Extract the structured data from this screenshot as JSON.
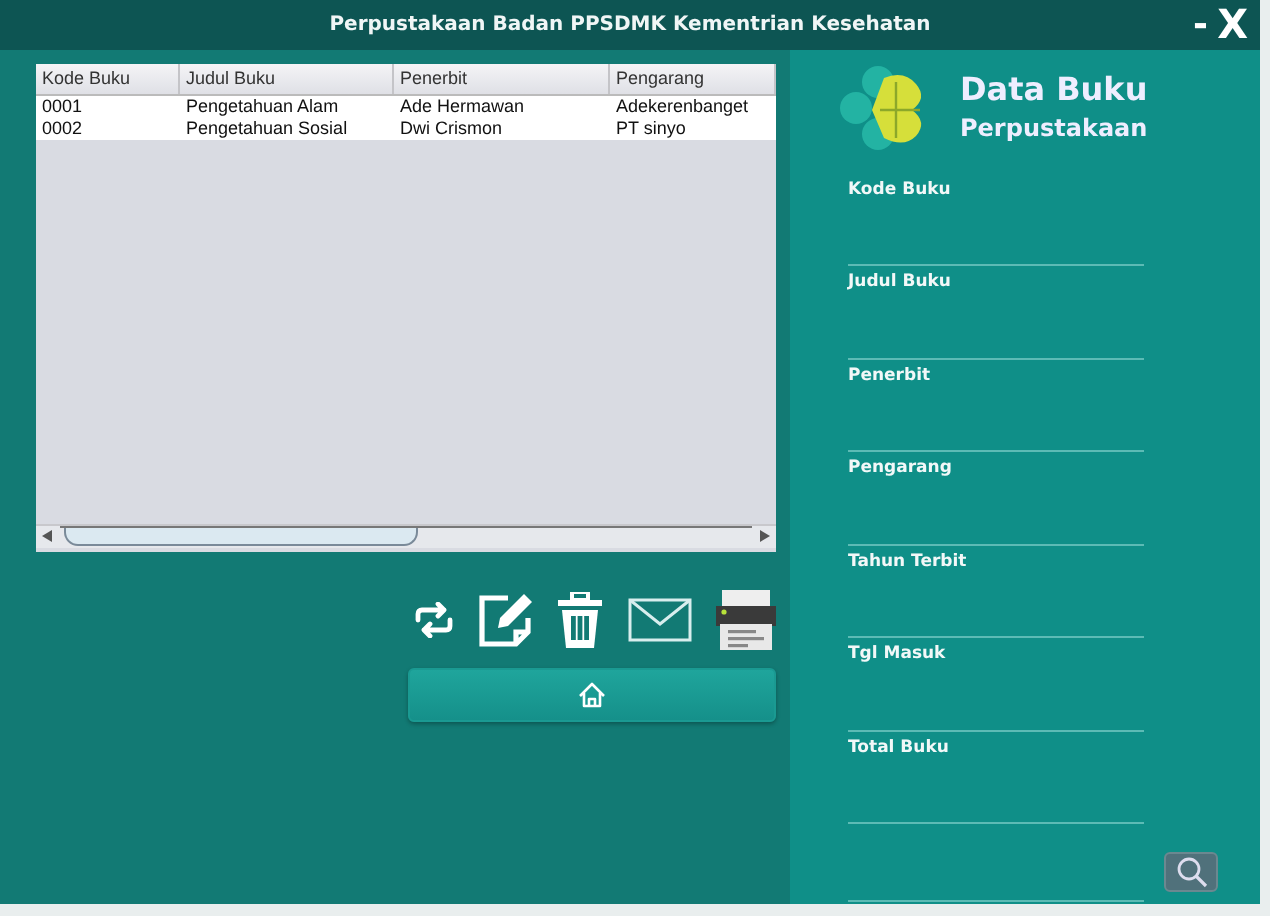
{
  "window": {
    "title": "Perpustakaan Badan PPSDMK Kementrian Kesehatan",
    "minimize": "-",
    "close": "X"
  },
  "table": {
    "columns": [
      "Kode Buku",
      "Judul Buku",
      "Penerbit",
      "Pengarang"
    ],
    "rows": [
      [
        "0001",
        "Pengetahuan Alam",
        "Ade Hermawan",
        "Adekerenbanget"
      ],
      [
        "0002",
        "Pengetahuan Sosial",
        "Dwi Crismon",
        "PT sinyo"
      ]
    ]
  },
  "form": {
    "title": "Data Buku",
    "subtitle": "Perpustakaan",
    "fields": [
      {
        "label": "Kode Buku"
      },
      {
        "label": "Judul Buku"
      },
      {
        "label": "Penerbit"
      },
      {
        "label": "Pengarang"
      },
      {
        "label": "Tahun Terbit"
      },
      {
        "label": "Tgl Masuk"
      },
      {
        "label": "Total Buku"
      }
    ]
  }
}
